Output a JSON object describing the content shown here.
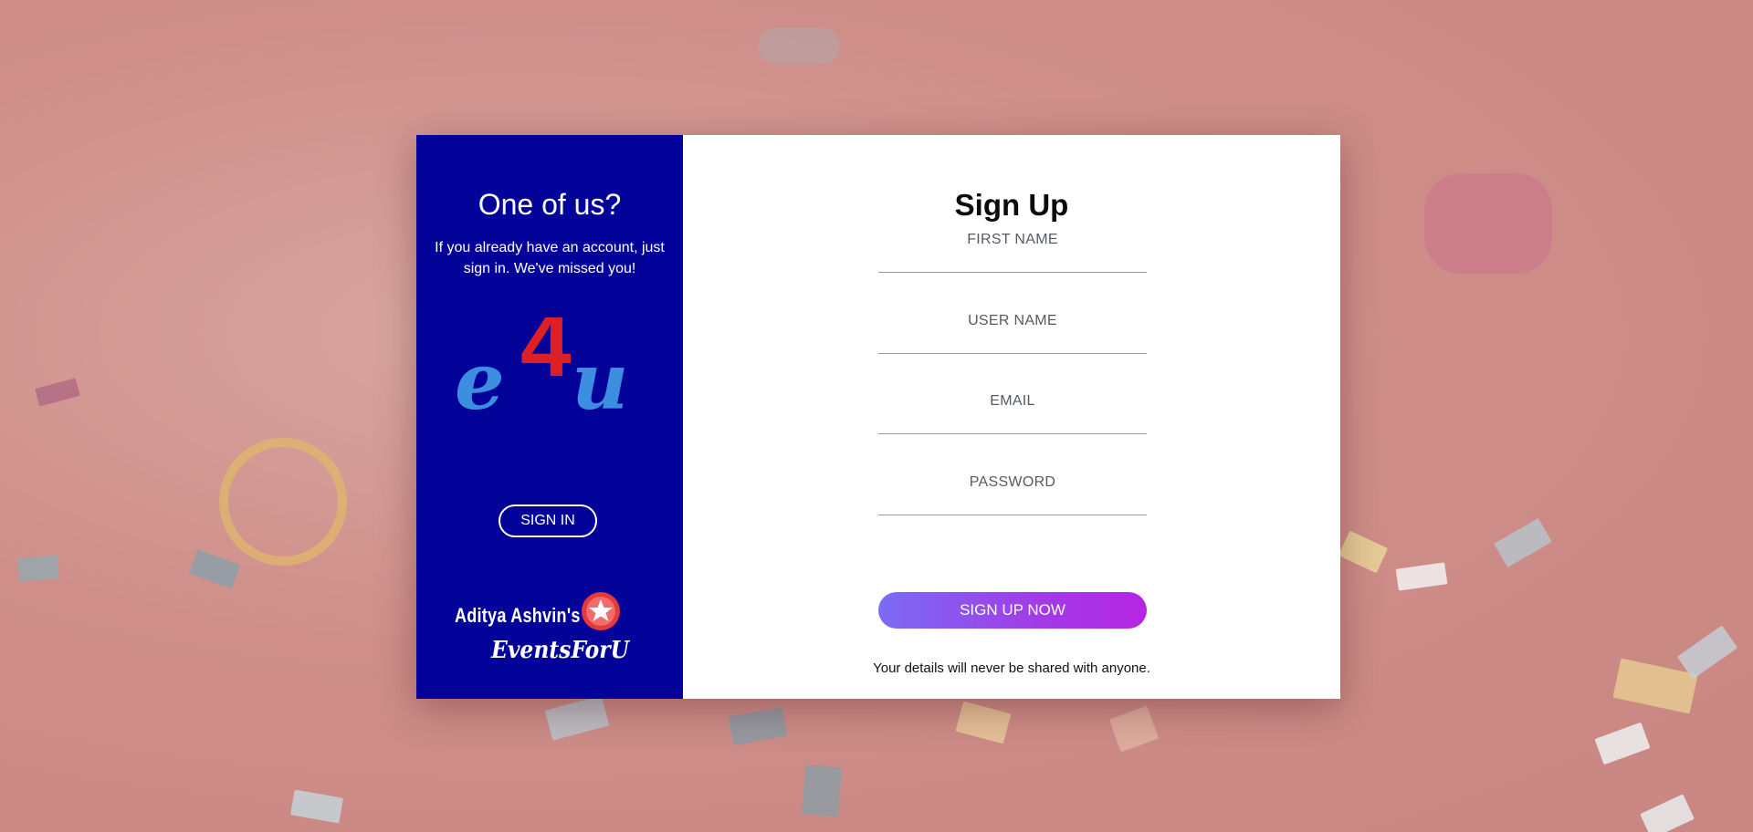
{
  "left_panel": {
    "title": "One of us?",
    "subtitle": "If you already have an account, just sign in. We've missed you!",
    "logo_text": "e4u",
    "signin_label": "SIGN IN",
    "brand_line1": "Aditya Ashvin's",
    "brand_line2": "EventsForU",
    "background_color": "#03039a"
  },
  "right_panel": {
    "title": "Sign Up",
    "fields": [
      {
        "placeholder": "FIRST NAME"
      },
      {
        "placeholder": "USER NAME"
      },
      {
        "placeholder": "EMAIL"
      },
      {
        "placeholder": "PASSWORD"
      }
    ],
    "submit_label": "SIGN UP NOW",
    "privacy_note": "Your details will never be shared with anyone.",
    "button_gradient_start": "#7b6cf5",
    "button_gradient_end": "#b625e3"
  }
}
